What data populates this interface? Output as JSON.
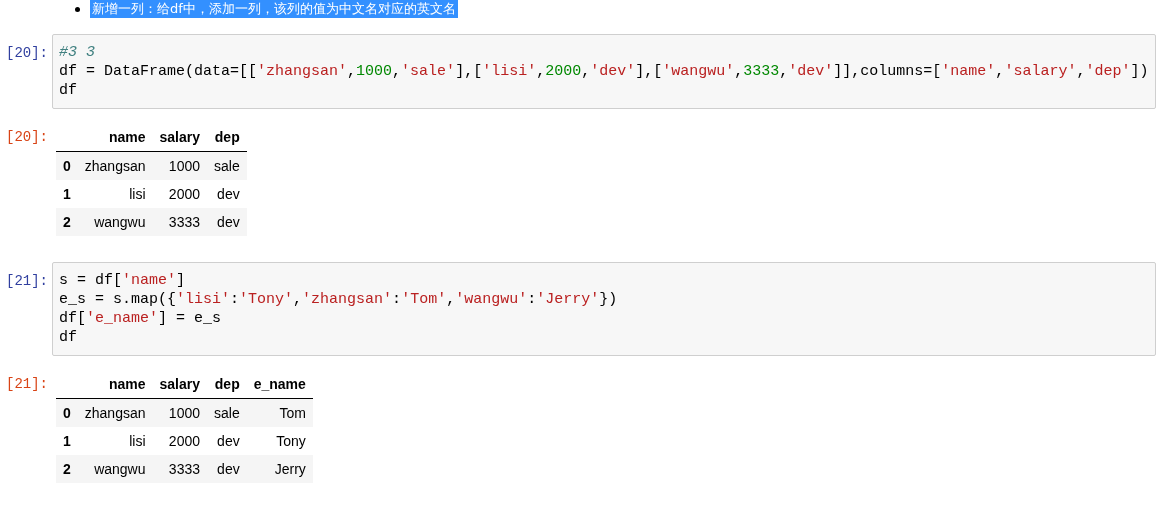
{
  "note": {
    "text": "新增一列：给df中，添加一列，该列的值为中文名对应的英文名",
    "selected": true
  },
  "cells": [
    {
      "kind": "input",
      "prompt": "[20]:",
      "lines": [
        [
          {
            "kind": "c",
            "s": "#3 3"
          }
        ],
        [
          {
            "kind": "p",
            "s": "df = DataFrame(data=[["
          },
          {
            "kind": "s",
            "s": "'zhangsan'"
          },
          {
            "kind": "p",
            "s": ","
          },
          {
            "kind": "n",
            "s": "1000"
          },
          {
            "kind": "p",
            "s": ","
          },
          {
            "kind": "s",
            "s": "'sale'"
          },
          {
            "kind": "p",
            "s": "],["
          },
          {
            "kind": "s",
            "s": "'lisi'"
          },
          {
            "kind": "p",
            "s": ","
          },
          {
            "kind": "n",
            "s": "2000"
          },
          {
            "kind": "p",
            "s": ","
          },
          {
            "kind": "s",
            "s": "'dev'"
          },
          {
            "kind": "p",
            "s": "],["
          },
          {
            "kind": "s",
            "s": "'wangwu'"
          },
          {
            "kind": "p",
            "s": ","
          },
          {
            "kind": "n",
            "s": "3333"
          },
          {
            "kind": "p",
            "s": ","
          },
          {
            "kind": "s",
            "s": "'dev'"
          },
          {
            "kind": "p",
            "s": "]],columns=["
          },
          {
            "kind": "s",
            "s": "'name'"
          },
          {
            "kind": "p",
            "s": ","
          },
          {
            "kind": "s",
            "s": "'salary'"
          },
          {
            "kind": "p",
            "s": ","
          },
          {
            "kind": "s",
            "s": "'dep'"
          },
          {
            "kind": "p",
            "s": "])"
          }
        ],
        [
          {
            "kind": "p",
            "s": "df"
          }
        ]
      ]
    },
    {
      "kind": "output",
      "prompt": "[20]:",
      "table": {
        "columns": [
          "",
          "name",
          "salary",
          "dep"
        ],
        "rows": [
          [
            "0",
            "zhangsan",
            "1000",
            "sale"
          ],
          [
            "1",
            "lisi",
            "2000",
            "dev"
          ],
          [
            "2",
            "wangwu",
            "3333",
            "dev"
          ]
        ]
      }
    },
    {
      "kind": "input",
      "prompt": "[21]:",
      "lines": [
        [
          {
            "kind": "p",
            "s": "s = df["
          },
          {
            "kind": "s",
            "s": "'name'"
          },
          {
            "kind": "p",
            "s": "]"
          }
        ],
        [
          {
            "kind": "p",
            "s": "e_s = s.map({"
          },
          {
            "kind": "s",
            "s": "'lisi'"
          },
          {
            "kind": "p",
            "s": ":"
          },
          {
            "kind": "s",
            "s": "'Tony'"
          },
          {
            "kind": "p",
            "s": ","
          },
          {
            "kind": "s",
            "s": "'zhangsan'"
          },
          {
            "kind": "p",
            "s": ":"
          },
          {
            "kind": "s",
            "s": "'Tom'"
          },
          {
            "kind": "p",
            "s": ","
          },
          {
            "kind": "s",
            "s": "'wangwu'"
          },
          {
            "kind": "p",
            "s": ":"
          },
          {
            "kind": "s",
            "s": "'Jerry'"
          },
          {
            "kind": "p",
            "s": "})"
          }
        ],
        [
          {
            "kind": "p",
            "s": "df["
          },
          {
            "kind": "s",
            "s": "'e_name'"
          },
          {
            "kind": "p",
            "s": "] = e_s"
          }
        ],
        [
          {
            "kind": "p",
            "s": "df"
          }
        ]
      ]
    },
    {
      "kind": "output",
      "prompt": "[21]:",
      "table": {
        "columns": [
          "",
          "name",
          "salary",
          "dep",
          "e_name"
        ],
        "rows": [
          [
            "0",
            "zhangsan",
            "1000",
            "sale",
            "Tom"
          ],
          [
            "1",
            "lisi",
            "2000",
            "dev",
            "Tony"
          ],
          [
            "2",
            "wangwu",
            "3333",
            "dev",
            "Jerry"
          ]
        ]
      }
    }
  ]
}
